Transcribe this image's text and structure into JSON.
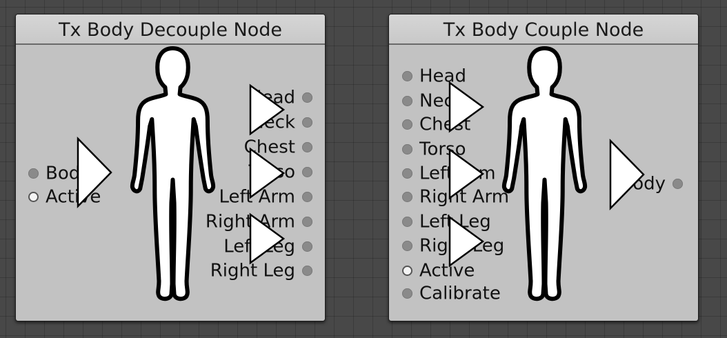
{
  "decouple_node": {
    "title": "Tx Body Decouple Node",
    "inputs": [
      {
        "label": "Body",
        "kind": "filled"
      },
      {
        "label": "Active",
        "kind": "hollow"
      }
    ],
    "outputs": [
      {
        "label": "Head"
      },
      {
        "label": "Neck"
      },
      {
        "label": "Chest"
      },
      {
        "label": "Torso"
      },
      {
        "label": "Left Arm"
      },
      {
        "label": "Right Arm"
      },
      {
        "label": "Left Leg"
      },
      {
        "label": "Right Leg"
      }
    ]
  },
  "couple_node": {
    "title": "Tx Body Couple Node",
    "inputs": [
      {
        "label": "Head",
        "kind": "filled"
      },
      {
        "label": "Neck",
        "kind": "filled"
      },
      {
        "label": "Chest",
        "kind": "filled"
      },
      {
        "label": "Torso",
        "kind": "filled"
      },
      {
        "label": "Left Arm",
        "kind": "filled"
      },
      {
        "label": "Right Arm",
        "kind": "filled"
      },
      {
        "label": "Left Leg",
        "kind": "filled"
      },
      {
        "label": "Right Leg",
        "kind": "filled"
      },
      {
        "label": "Active",
        "kind": "hollow"
      },
      {
        "label": "Calibrate",
        "kind": "filled"
      }
    ],
    "outputs": [
      {
        "label": "Body"
      }
    ]
  },
  "icons": {
    "figure": "human-silhouette-icon",
    "arrow": "play-arrow-icon",
    "port": "port-dot-icon"
  },
  "colors": {
    "canvas": "#484848",
    "node_body": "#c2c2c2",
    "port_dot": "#8a8a8a",
    "text": "#111111"
  }
}
